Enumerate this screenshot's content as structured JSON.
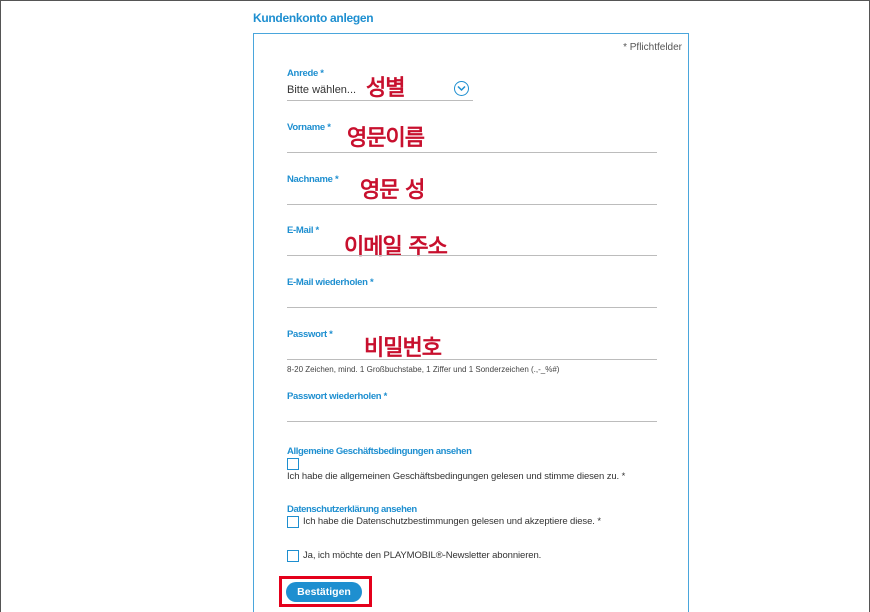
{
  "form": {
    "title": "Kundenkonto anlegen",
    "required_note": "* Pflichtfelder",
    "anrede": {
      "label": "Anrede *",
      "value": "Bitte wählen...",
      "annotation": "성별"
    },
    "vorname": {
      "label": "Vorname *",
      "annotation": "영문이름"
    },
    "nachname": {
      "label": "Nachname *",
      "annotation": "영문 성"
    },
    "email": {
      "label": "E-Mail *",
      "annotation": "이메일 주소"
    },
    "email_repeat": {
      "label": "E-Mail wiederholen *"
    },
    "passwort": {
      "label": "Passwort *",
      "annotation": "비밀번호",
      "hint": "8-20 Zeichen, mind. 1 Großbuchstabe, 1 Ziffer und 1 Sonderzeichen (.,-_%#)"
    },
    "passwort_repeat": {
      "label": "Passwort wiederholen *"
    },
    "agb": {
      "link": "Allgemeine Geschäftsbedingungen ansehen",
      "checkbox_label": "Ich habe die allgemeinen Geschäftsbedingungen gelesen und stimme diesen zu. *"
    },
    "datenschutz": {
      "link": "Datenschutzerklärung ansehen",
      "checkbox_label": "Ich habe die Datenschutzbestimmungen gelesen und akzeptiere diese. *"
    },
    "newsletter": {
      "checkbox_label": "Ja, ich möchte den PLAYMOBIL®-Newsletter abonnieren."
    },
    "submit_label": "Bestätigen"
  },
  "colors": {
    "accent": "#1e8fd0",
    "annotation": "#c8102e",
    "highlight": "#e4001b"
  }
}
